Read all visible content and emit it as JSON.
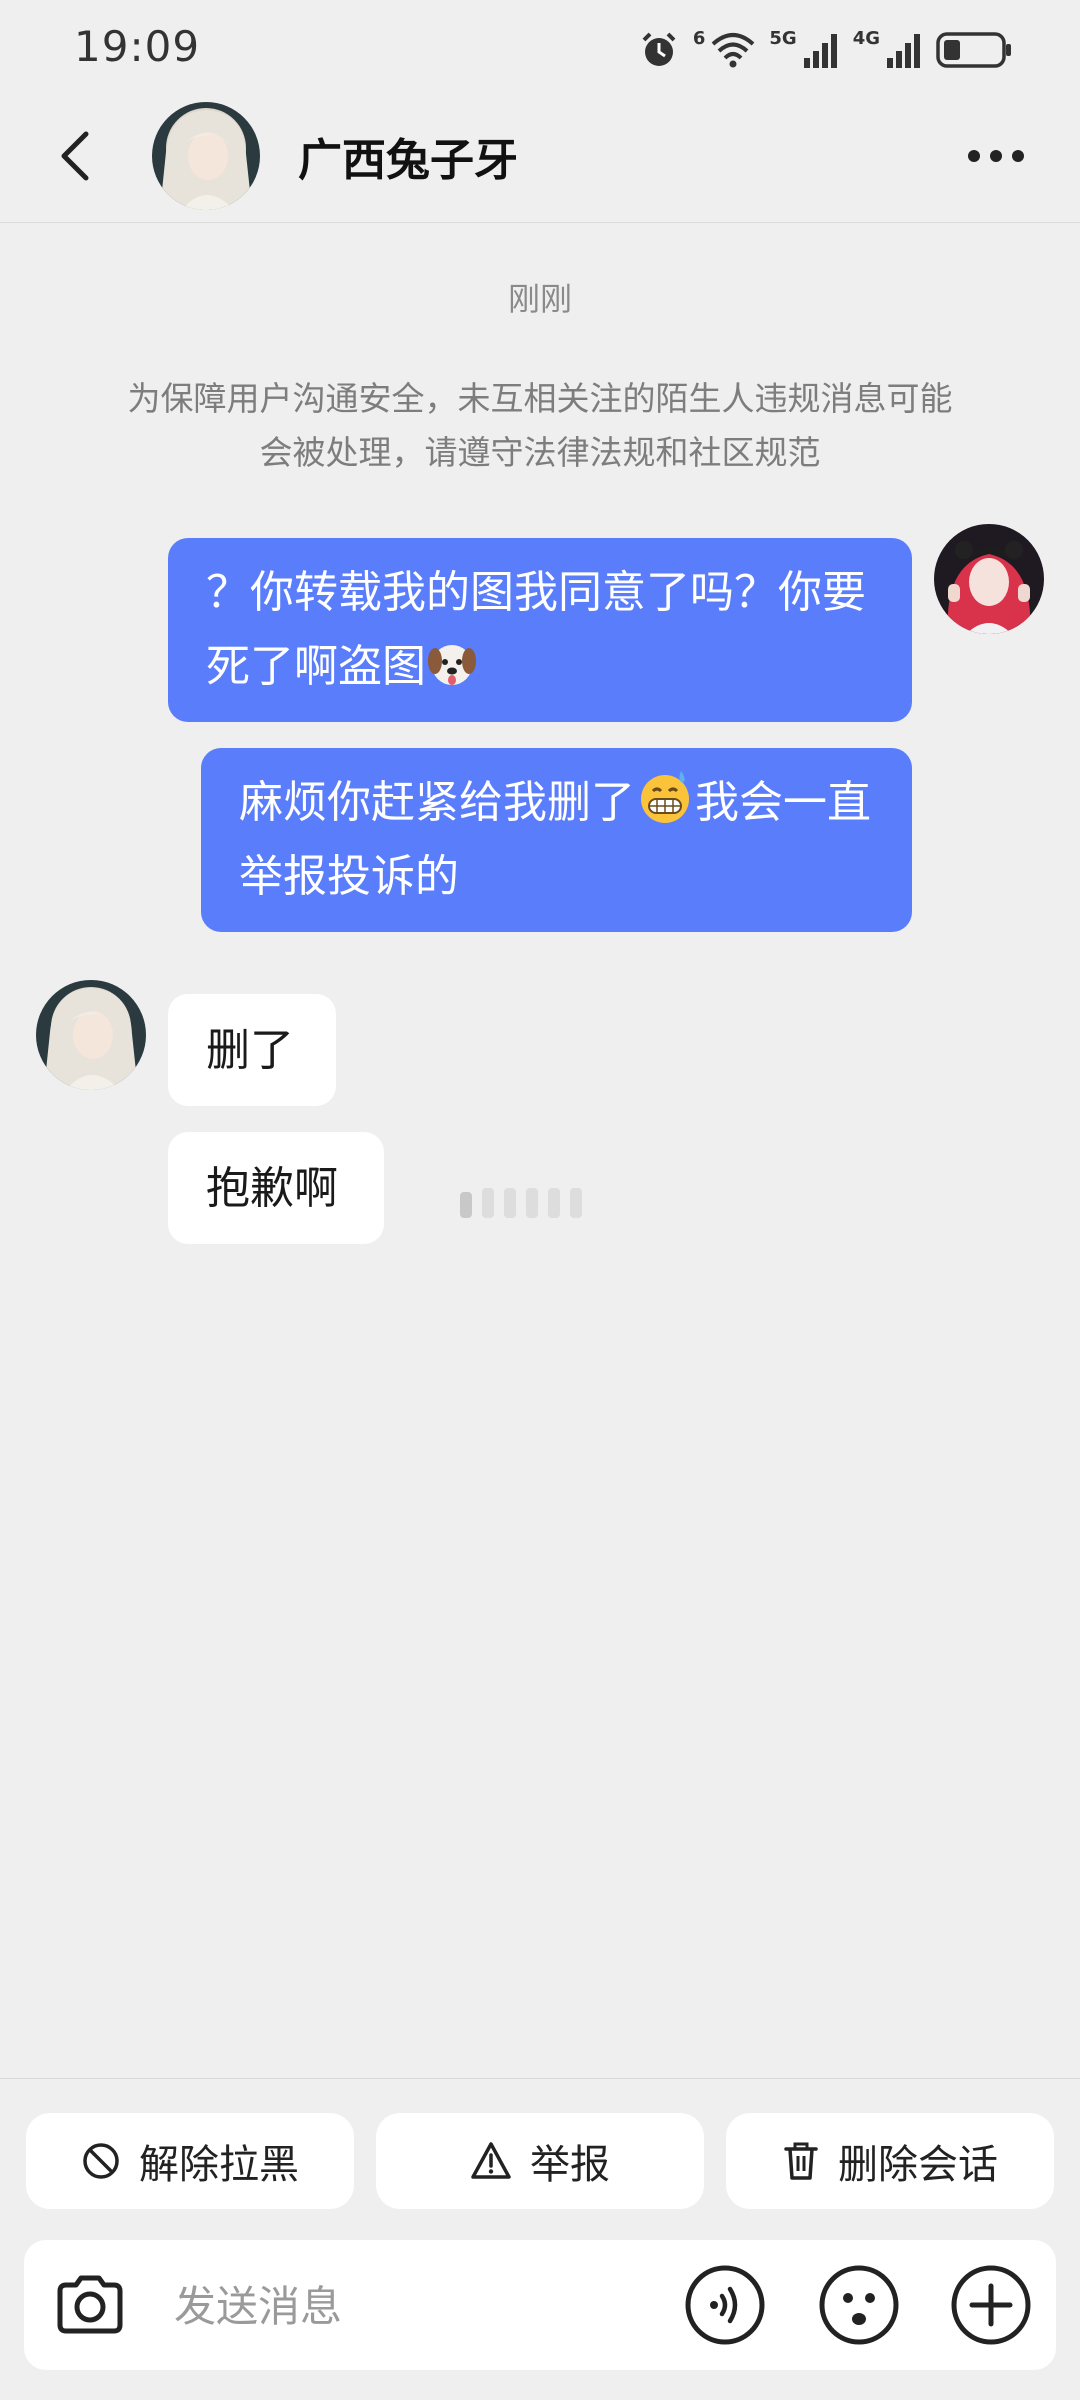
{
  "status_bar": {
    "time": "19:09",
    "network_1": "5G",
    "network_2": "4G",
    "wifi_badge": "6"
  },
  "header": {
    "title": "广西兔子牙"
  },
  "chat": {
    "timestamp": "刚刚",
    "notice": "为保障用户沟通安全，未互相关注的陌生人违规消息可能会被处理，请遵守法律法规和社区规范",
    "messages": [
      {
        "side": "out",
        "text_a": "？你转载我的图我同意了吗？你要死了啊盗图",
        "emoji": "dog-face"
      },
      {
        "side": "out",
        "text_a": "麻烦你赶紧给我删了",
        "emoji": "grinning-sweat",
        "text_b": "我会一直举报投诉的"
      },
      {
        "side": "in",
        "text_a": "删了"
      },
      {
        "side": "in",
        "text_a": "抱歉啊"
      }
    ]
  },
  "actions": {
    "unblock": "解除拉黑",
    "report": "举报",
    "delete": "删除会话"
  },
  "composer": {
    "placeholder": "发送消息"
  },
  "colors": {
    "outgoing_bubble": "#5a7dfb",
    "incoming_bubble": "#ffffff",
    "background": "#efeff0"
  }
}
